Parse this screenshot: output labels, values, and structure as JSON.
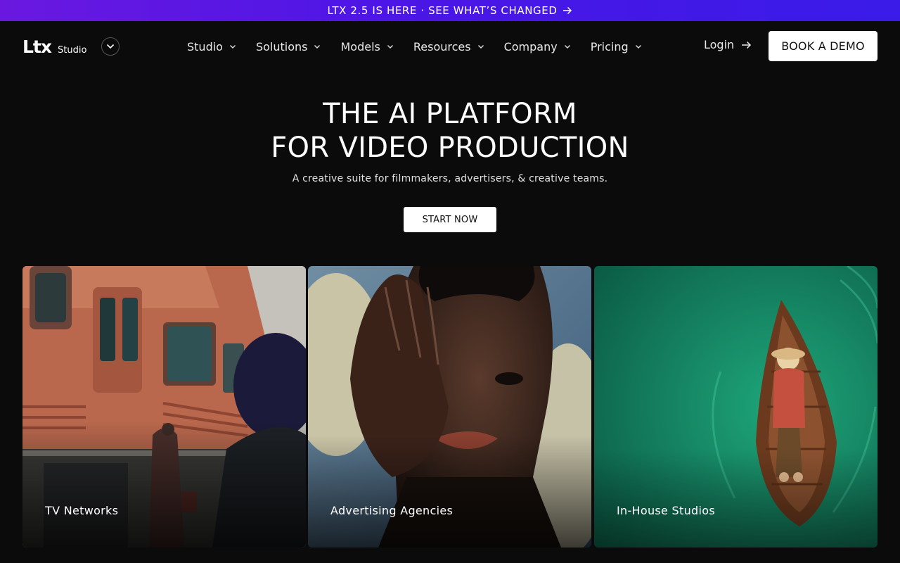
{
  "announcement": {
    "text": "LTX 2.5 IS HERE · SEE WHAT’S CHANGED",
    "icon": "arrow-right-icon"
  },
  "brand": {
    "logo": "Ltx",
    "product": "Studio",
    "toggle_icon": "chevron-down-icon"
  },
  "nav": {
    "items": [
      {
        "label": "Studio"
      },
      {
        "label": "Solutions"
      },
      {
        "label": "Models"
      },
      {
        "label": "Resources"
      },
      {
        "label": "Company"
      },
      {
        "label": "Pricing"
      }
    ],
    "login": "Login",
    "cta": "BOOK A DEMO"
  },
  "hero": {
    "title_line1": "THE AI PLATFORM",
    "title_line2": "FOR VIDEO PRODUCTION",
    "subtitle": "A creative suite for filmmakers, advertisers, & creative teams.",
    "cta": "START NOW"
  },
  "cards": [
    {
      "label": "TV Networks"
    },
    {
      "label": "Advertising Agencies"
    },
    {
      "label": "In-House Studios"
    }
  ],
  "colors": {
    "background": "#0b0b0b",
    "banner_start": "#6a18e0",
    "banner_end": "#3a1be8",
    "button_bg": "#ffffff",
    "button_text": "#111111",
    "teal": "#138a66"
  }
}
